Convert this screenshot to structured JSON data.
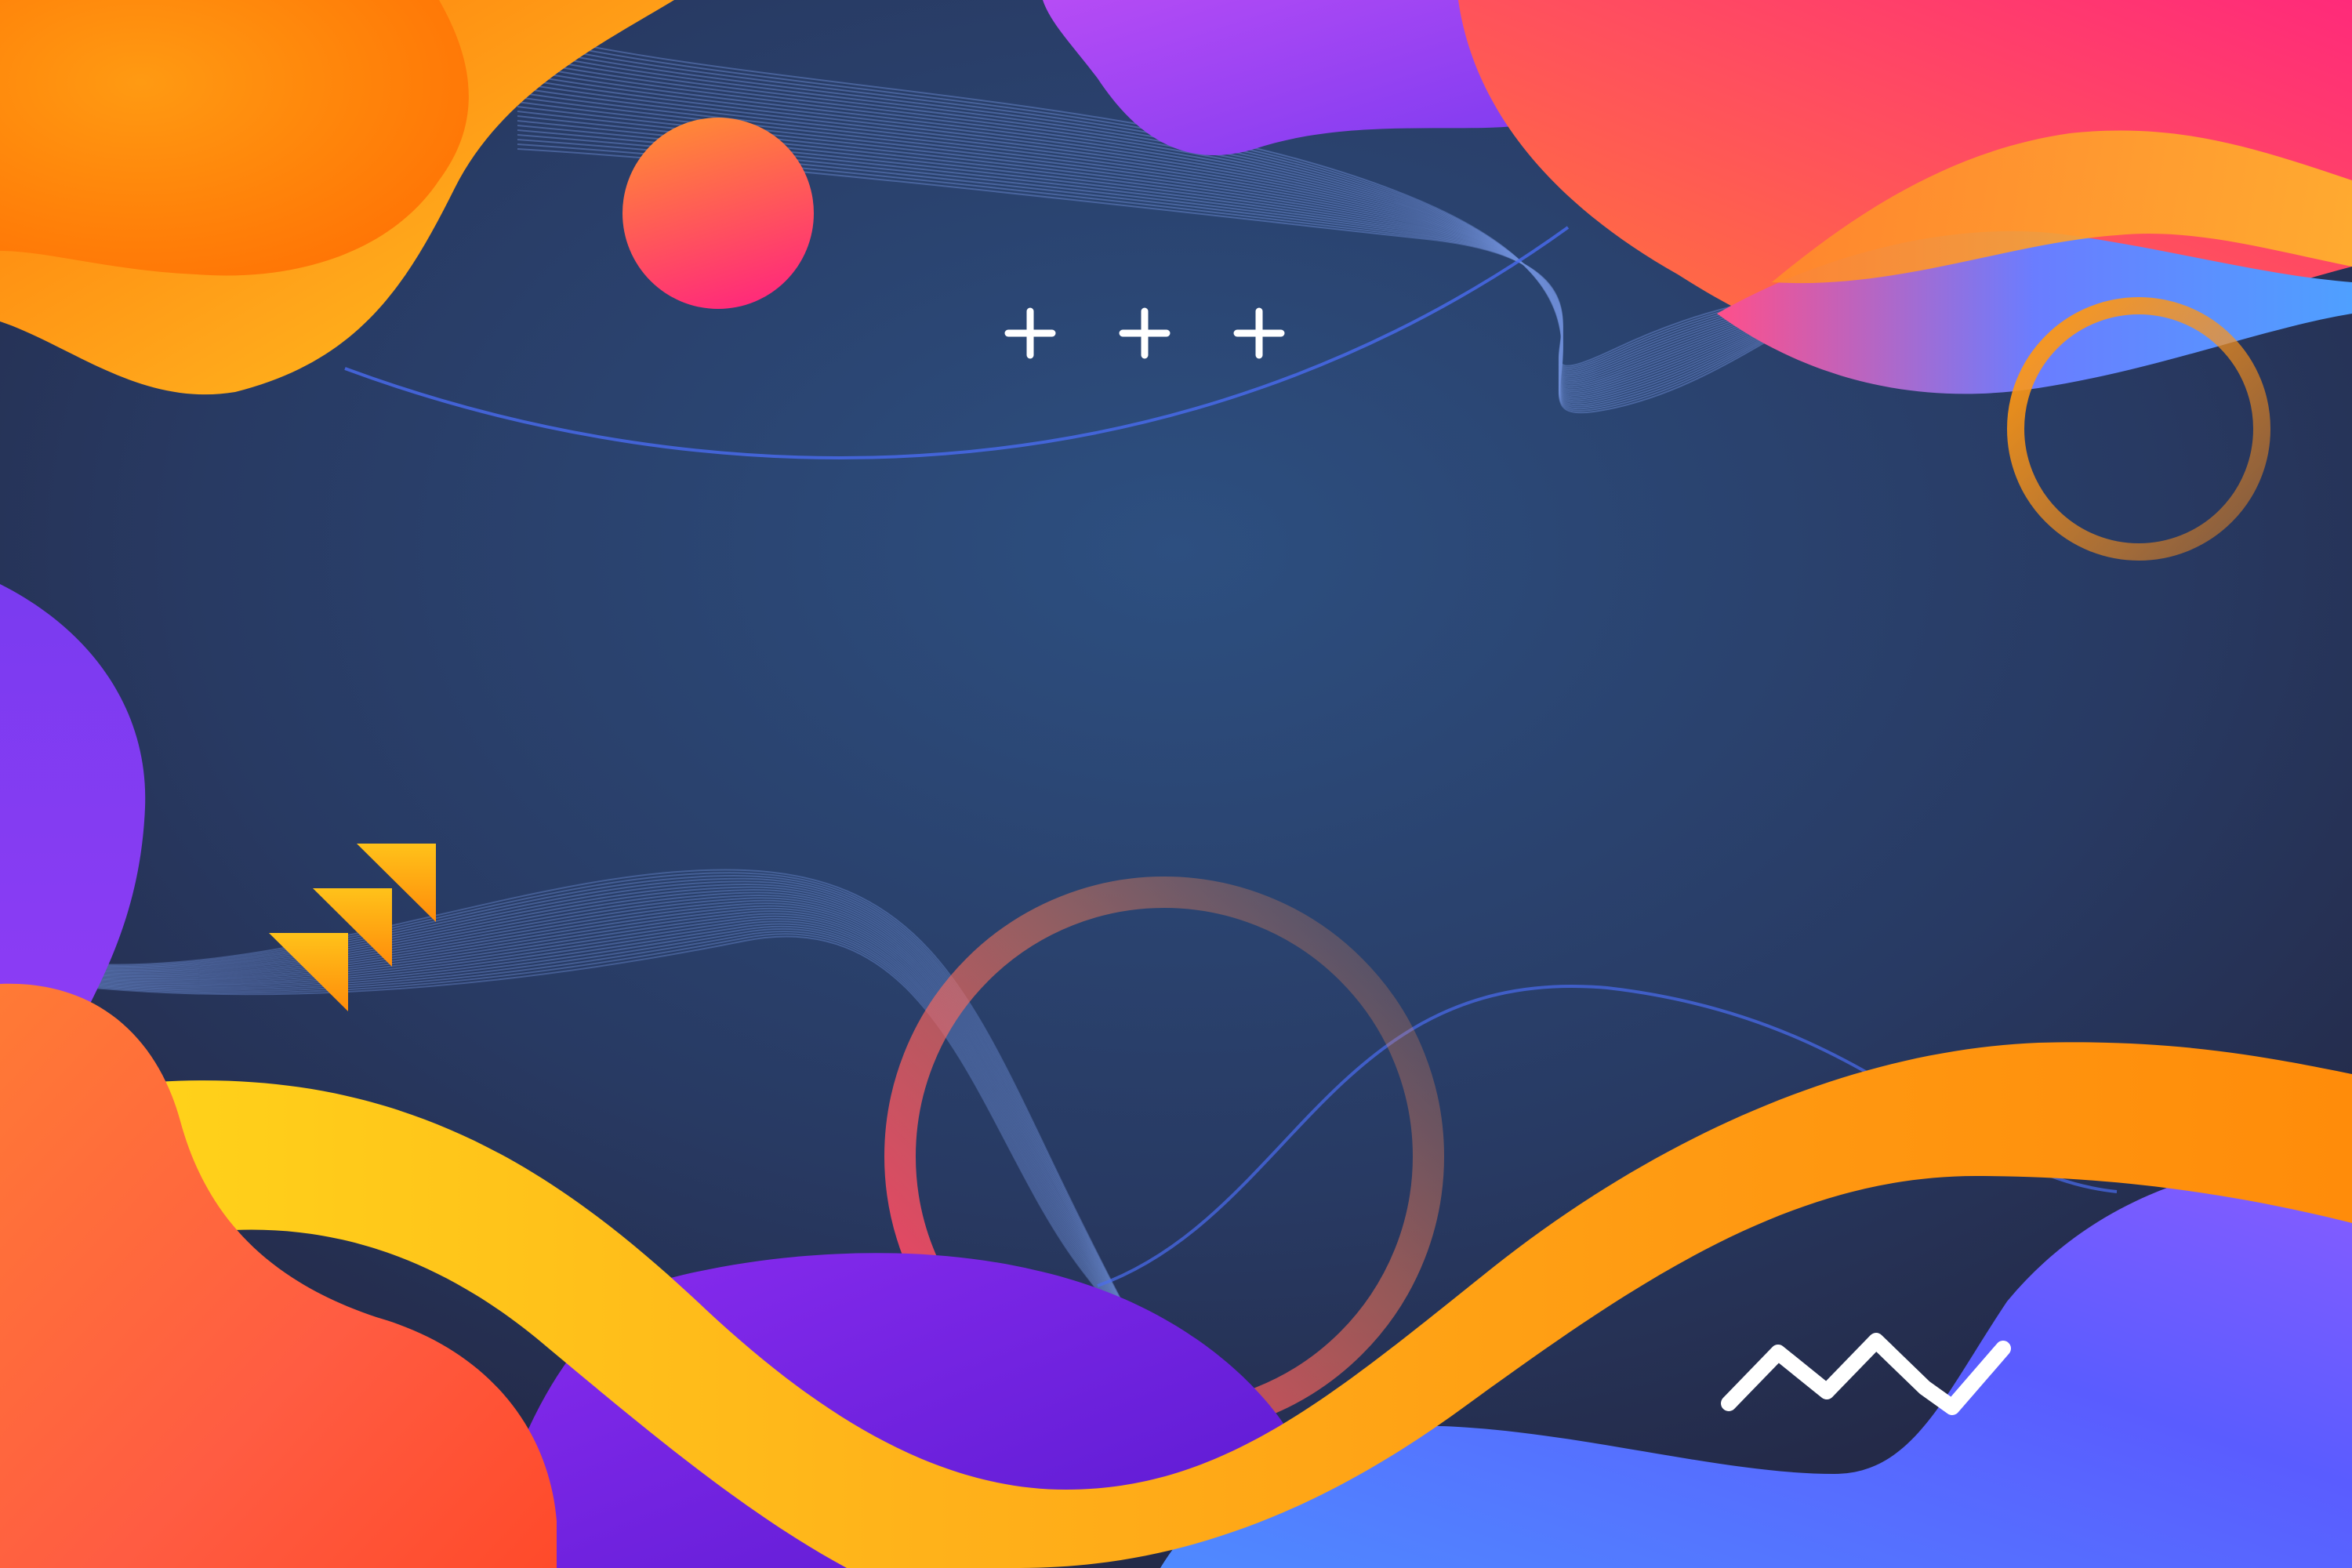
{
  "artwork": {
    "style": "abstract fluid gradient background",
    "colors": {
      "background_center": "#2c4a78",
      "background_edge": "#232640",
      "orange": "#ff8c1a",
      "yellow": "#ffc21a",
      "coral": "#ff5a52",
      "pink": "#ff2d7a",
      "purple": "#8a3cf0",
      "violet": "#6a22d8",
      "blue": "#5a7cff",
      "white": "#ffffff"
    },
    "decorations": [
      "plus-sign-icon",
      "plus-sign-icon",
      "plus-sign-icon",
      "orange-ring",
      "gradient-ring",
      "gradient-circle",
      "triangle-arrow-icon",
      "triangle-arrow-icon",
      "triangle-arrow-icon",
      "zigzag-line-icon",
      "line-wave"
    ]
  }
}
